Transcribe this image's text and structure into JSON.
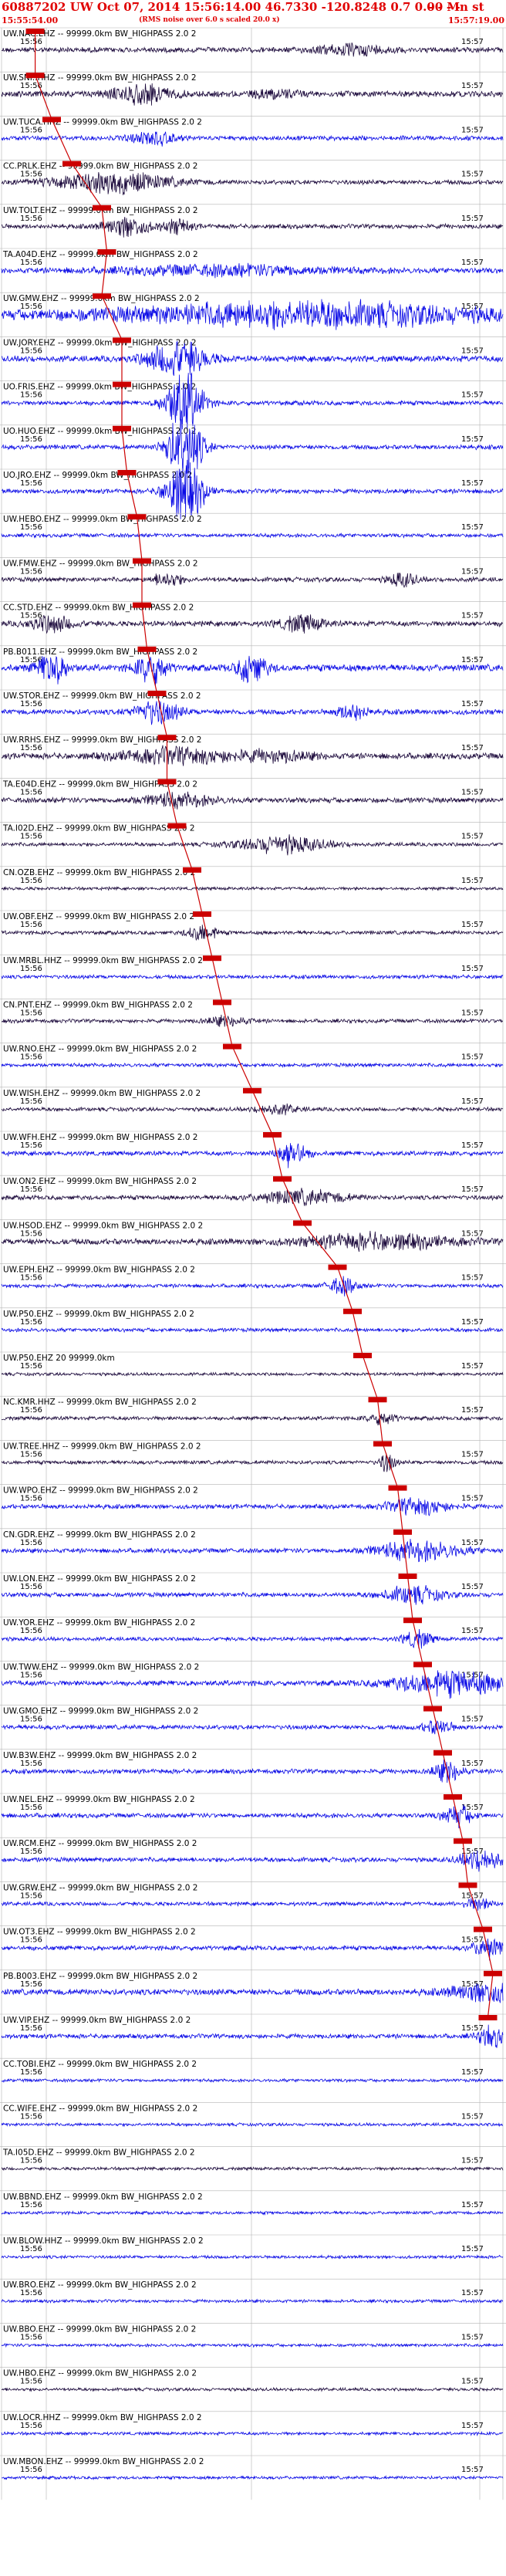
{
  "header": {
    "title": "60887202 UW Oct 07, 2014 15:56:14.00   46.7330 -120.8248  0.7 0.00 Mn st",
    "dashes": "- - - -",
    "start_time": "15:55:54.00",
    "rms_note": "(RMS noise over 6.0 s scaled 20.0 x)",
    "end_time": "15:57:19.00"
  },
  "colors": {
    "header": "#e00000",
    "pick": "#cc0000",
    "trace_alt": "#0a0ae6",
    "trace_base": "#1c0a3c",
    "grid": "#b4b4b4"
  },
  "chart_data": {
    "type": "line",
    "title": "60887202 UW Oct 07, 2014 15:56:14.00   46.7330 -120.8248  0.7 0.00 Mn st",
    "x_range": [
      "15:55:54.00",
      "15:57:19.00"
    ],
    "xlabel": "",
    "ylabel": "",
    "grid": true,
    "traces": [
      {
        "label": "UW.NAC.EHZ -- 99999.0km BW_HIGHPASS 2.0 2",
        "t1": "15:56",
        "t2": "15:57",
        "amp": 0.7,
        "pick": 0.067,
        "color": "dark",
        "bursts": [
          [
            0.7,
            0.05,
            1.6
          ]
        ]
      },
      {
        "label": "UW.SNI..HHZ -- 99999.0km BW_HIGHPASS 2.0 2",
        "t1": "15:56",
        "t2": "15:57",
        "amp": 0.8,
        "pick": 0.067,
        "color": "dark",
        "bursts": [
          [
            0.28,
            0.04,
            2
          ],
          [
            0.55,
            0.03,
            1.5
          ]
        ]
      },
      {
        "label": "UW.TUCA.HHZ -- 99999.0km BW_HIGHPASS 2.0 2",
        "t1": "15:56",
        "t2": "15:57",
        "amp": 0.6,
        "pick": 0.1,
        "color": "blue",
        "bursts": [
          [
            0.3,
            0.03,
            2
          ]
        ]
      },
      {
        "label": "CC.PRLK.EHZ -- 99999.0km BW_HIGHPASS 2.0 2",
        "t1": "15:56",
        "t2": "15:57",
        "amp": 0.6,
        "pick": 0.14,
        "color": "dark",
        "bursts": [
          [
            0.22,
            0.08,
            2.5
          ]
        ]
      },
      {
        "label": "UW.TOLT.EHZ -- 99999.0km BW_HIGHPASS 2.0 2",
        "t1": "15:56",
        "t2": "15:57",
        "amp": 0.6,
        "pick": 0.2,
        "color": "dark",
        "bursts": [
          [
            0.25,
            0.03,
            2.5
          ],
          [
            0.35,
            0.02,
            2
          ]
        ]
      },
      {
        "label": "TA.A04D.EHZ -- 99999.0km BW_HIGHPASS 2.0 2",
        "t1": "15:56",
        "t2": "15:57",
        "amp": 0.7,
        "pick": 0.21,
        "color": "blue",
        "bursts": [
          [
            0.45,
            0.15,
            1.6
          ]
        ]
      },
      {
        "label": "UW.GMW.EHZ -- 99999.0km BW_HIGHPASS 2.0 2",
        "t1": "15:56",
        "t2": "15:57",
        "amp": 1.2,
        "pick": 0.2,
        "color": "blue",
        "bursts": [
          [
            0.6,
            0.25,
            1.8
          ]
        ]
      },
      {
        "label": "UW.JORY.EHZ -- 99999.0km BW_HIGHPASS 2.0 2",
        "t1": "15:56",
        "t2": "15:57",
        "amp": 0.8,
        "pick": 0.24,
        "color": "blue",
        "bursts": [
          [
            0.35,
            0.04,
            3
          ]
        ]
      },
      {
        "label": "UO.FRIS.EHZ -- 99999.0km BW_HIGHPASS 2.0 2",
        "t1": "15:56",
        "t2": "15:57",
        "amp": 0.6,
        "pick": 0.24,
        "color": "blue",
        "bursts": [
          [
            0.35,
            0.02,
            4
          ],
          [
            0.38,
            0.02,
            4
          ]
        ]
      },
      {
        "label": "UO.HUO.EHZ -- 99999.0km BW_HIGHPASS 2.0 2",
        "t1": "15:56",
        "t2": "15:57",
        "amp": 0.6,
        "pick": 0.24,
        "color": "blue",
        "bursts": [
          [
            0.35,
            0.02,
            4
          ],
          [
            0.38,
            0.02,
            4
          ]
        ]
      },
      {
        "label": "UO.JRO.EHZ -- 99999.0km BW_HIGHPASS 2.0 2",
        "t1": "15:56",
        "t2": "15:57",
        "amp": 0.6,
        "pick": 0.25,
        "color": "blue",
        "bursts": [
          [
            0.35,
            0.02,
            4
          ],
          [
            0.38,
            0.02,
            4
          ]
        ]
      },
      {
        "label": "UW.HEBO.EHZ -- 99999.0km BW_HIGHPASS 2.0 2",
        "t1": "15:56",
        "t2": "15:57",
        "amp": 0.5,
        "pick": 0.27,
        "color": "blue",
        "bursts": []
      },
      {
        "label": "UW.FMW.EHZ -- 99999.0km BW_HIGHPASS 2.0 2",
        "t1": "15:56",
        "t2": "15:57",
        "amp": 0.6,
        "pick": 0.28,
        "color": "dark",
        "bursts": [
          [
            0.33,
            0.02,
            2
          ],
          [
            0.8,
            0.02,
            2
          ]
        ]
      },
      {
        "label": "CC.STD.EHZ -- 99999.0km BW_HIGHPASS 2.0 2",
        "t1": "15:56",
        "t2": "15:57",
        "amp": 0.7,
        "pick": 0.28,
        "color": "dark",
        "bursts": [
          [
            0.1,
            0.03,
            2
          ],
          [
            0.6,
            0.03,
            2
          ]
        ]
      },
      {
        "label": "PB.B011.EHZ -- 99999.0km BW_HIGHPASS 2.0 2",
        "t1": "15:56",
        "t2": "15:57",
        "amp": 0.9,
        "pick": 0.29,
        "color": "blue",
        "bursts": [
          [
            0.1,
            0.02,
            2.5
          ],
          [
            0.3,
            0.02,
            2.5
          ],
          [
            0.5,
            0.02,
            2.5
          ]
        ]
      },
      {
        "label": "UW.STOR.EHZ -- 99999.0km BW_HIGHPASS 2.0 2",
        "t1": "15:56",
        "t2": "15:57",
        "amp": 0.7,
        "pick": 0.31,
        "color": "blue",
        "bursts": [
          [
            0.31,
            0.03,
            2.5
          ],
          [
            0.7,
            0.02,
            2
          ]
        ]
      },
      {
        "label": "UW.RRHS.EHZ -- 99999.0km BW_HIGHPASS 2.0 2",
        "t1": "15:56",
        "t2": "15:57",
        "amp": 0.8,
        "pick": 0.33,
        "color": "dark",
        "bursts": [
          [
            0.35,
            0.08,
            1.8
          ],
          [
            0.55,
            0.05,
            1.5
          ]
        ]
      },
      {
        "label": "TA.E04D.EHZ -- 99999.0km BW_HIGHPASS 2.0 2",
        "t1": "15:56",
        "t2": "15:57",
        "amp": 0.7,
        "pick": 0.33,
        "color": "dark",
        "bursts": [
          [
            0.35,
            0.05,
            1.8
          ]
        ]
      },
      {
        "label": "TA.I02D.EHZ -- 99999.0km BW_HIGHPASS 2.0 2",
        "t1": "15:56",
        "t2": "15:57",
        "amp": 0.5,
        "pick": 0.35,
        "color": "dark",
        "bursts": [
          [
            0.56,
            0.06,
            2.5
          ]
        ]
      },
      {
        "label": "CN.OZB.EHZ -- 99999.0km BW_HIGHPASS 2.0 2",
        "t1": "15:56",
        "t2": "15:57",
        "amp": 0.4,
        "pick": 0.38,
        "color": "dark",
        "bursts": []
      },
      {
        "label": "UW.OBF.EHZ -- 99999.0km BW_HIGHPASS 2.0 2",
        "t1": "15:56",
        "t2": "15:57",
        "amp": 0.5,
        "pick": 0.4,
        "color": "dark",
        "bursts": [
          [
            0.4,
            0.02,
            2.5
          ]
        ]
      },
      {
        "label": "UW.MRBL.HHZ -- 99999.0km BW_HIGHPASS 2.0 2",
        "t1": "15:56",
        "t2": "15:57",
        "amp": 0.5,
        "pick": 0.42,
        "color": "blue",
        "bursts": []
      },
      {
        "label": "CN.PNT.EHZ -- 99999.0km BW_HIGHPASS 2.0 2",
        "t1": "15:56",
        "t2": "15:57",
        "amp": 0.5,
        "pick": 0.44,
        "color": "dark",
        "bursts": [
          [
            0.45,
            0.03,
            1.8
          ]
        ]
      },
      {
        "label": "UW.RNO.EHZ -- 99999.0km BW_HIGHPASS 2.0 2",
        "t1": "15:56",
        "t2": "15:57",
        "amp": 0.5,
        "pick": 0.46,
        "color": "blue",
        "bursts": []
      },
      {
        "label": "UW.WISH.EHZ -- 99999.0km BW_HIGHPASS 2.0 2",
        "t1": "15:56",
        "t2": "15:57",
        "amp": 0.5,
        "pick": 0.5,
        "color": "dark",
        "bursts": [
          [
            0.55,
            0.03,
            1.8
          ]
        ]
      },
      {
        "label": "UW.WFH.EHZ -- 99999.0km BW_HIGHPASS 2.0 2",
        "t1": "15:56",
        "t2": "15:57",
        "amp": 0.6,
        "pick": 0.54,
        "color": "blue",
        "bursts": [
          [
            0.58,
            0.02,
            3
          ]
        ]
      },
      {
        "label": "UW.ON2.EHZ -- 99999.0km BW_HIGHPASS 2.0 2",
        "t1": "15:56",
        "t2": "15:57",
        "amp": 0.6,
        "pick": 0.56,
        "color": "dark",
        "bursts": [
          [
            0.6,
            0.06,
            2
          ]
        ]
      },
      {
        "label": "UW.HSOD.EHZ -- 99999.0km BW_HIGHPASS 2.0 2",
        "t1": "15:56",
        "t2": "15:57",
        "amp": 0.8,
        "pick": 0.6,
        "color": "dark",
        "bursts": [
          [
            0.75,
            0.1,
            1.8
          ]
        ]
      },
      {
        "label": "UW.EPH.EHZ -- 99999.0km BW_HIGHPASS 2.0 2",
        "t1": "15:56",
        "t2": "15:57",
        "amp": 0.5,
        "pick": 0.67,
        "color": "blue",
        "bursts": [
          [
            0.68,
            0.02,
            2.5
          ]
        ]
      },
      {
        "label": "UW.P50.EHZ -- 99999.0km BW_HIGHPASS 2.0 2",
        "t1": "15:56",
        "t2": "15:57",
        "amp": 0.5,
        "pick": 0.7,
        "color": "blue",
        "bursts": []
      },
      {
        "label": "UW.P50.EHZ 20 99999.0km",
        "t1": "15:56",
        "t2": "15:57",
        "amp": 0.4,
        "pick": 0.72,
        "color": "dark",
        "bursts": []
      },
      {
        "label": "NC.KMR.HHZ -- 99999.0km BW_HIGHPASS 2.0 2",
        "t1": "15:56",
        "t2": "15:57",
        "amp": 0.5,
        "pick": 0.75,
        "color": "dark",
        "bursts": [
          [
            0.76,
            0.02,
            2
          ]
        ]
      },
      {
        "label": "UW.TREE.HHZ -- 99999.0km BW_HIGHPASS 2.0 2",
        "t1": "15:56",
        "t2": "15:57",
        "amp": 0.5,
        "pick": 0.76,
        "color": "dark",
        "bursts": [
          [
            0.77,
            0.01,
            3
          ]
        ]
      },
      {
        "label": "UW.WPO.EHZ -- 99999.0km BW_HIGHPASS 2.0 2",
        "t1": "15:56",
        "t2": "15:57",
        "amp": 0.6,
        "pick": 0.79,
        "color": "blue",
        "bursts": [
          [
            0.83,
            0.04,
            2.2
          ]
        ]
      },
      {
        "label": "CN.GDR.EHZ -- 99999.0km BW_HIGHPASS 2.0 2",
        "t1": "15:56",
        "t2": "15:57",
        "amp": 0.6,
        "pick": 0.8,
        "color": "blue",
        "bursts": [
          [
            0.83,
            0.06,
            2.4
          ]
        ]
      },
      {
        "label": "UW.LON.EHZ -- 99999.0km BW_HIGHPASS 2.0 2",
        "t1": "15:56",
        "t2": "15:57",
        "amp": 0.6,
        "pick": 0.81,
        "color": "blue",
        "bursts": [
          [
            0.82,
            0.04,
            2.2
          ]
        ]
      },
      {
        "label": "UW.YOR.EHZ -- 99999.0km BW_HIGHPASS 2.0 2",
        "t1": "15:56",
        "t2": "15:57",
        "amp": 0.5,
        "pick": 0.82,
        "color": "blue",
        "bursts": [
          [
            0.83,
            0.02,
            2.5
          ]
        ]
      },
      {
        "label": "UW.TWW.EHZ -- 99999.0km BW_HIGHPASS 2.0 2",
        "t1": "15:56",
        "t2": "15:57",
        "amp": 0.7,
        "pick": 0.84,
        "color": "blue",
        "bursts": [
          [
            0.9,
            0.08,
            2.5
          ]
        ]
      },
      {
        "label": "UW.GMO.EHZ -- 99999.0km BW_HIGHPASS 2.0 2",
        "t1": "15:56",
        "t2": "15:57",
        "amp": 0.6,
        "pick": 0.86,
        "color": "blue",
        "bursts": [
          [
            0.87,
            0.02,
            2
          ]
        ]
      },
      {
        "label": "UW.B3W.EHZ -- 99999.0km BW_HIGHPASS 2.0 2",
        "t1": "15:56",
        "t2": "15:57",
        "amp": 0.6,
        "pick": 0.88,
        "color": "blue",
        "bursts": [
          [
            0.89,
            0.02,
            2.5
          ]
        ]
      },
      {
        "label": "UW.NEL.EHZ -- 99999.0km BW_HIGHPASS 2.0 2",
        "t1": "15:56",
        "t2": "15:57",
        "amp": 0.6,
        "pick": 0.9,
        "color": "blue",
        "bursts": [
          [
            0.91,
            0.02,
            2.5
          ]
        ]
      },
      {
        "label": "UW.RCM.EHZ -- 99999.0km BW_HIGHPASS 2.0 2",
        "t1": "15:56",
        "t2": "15:57",
        "amp": 0.6,
        "pick": 0.92,
        "color": "blue",
        "bursts": [
          [
            0.96,
            0.03,
            2.5
          ]
        ]
      },
      {
        "label": "UW.GRW.EHZ -- 99999.0km BW_HIGHPASS 2.0 2",
        "t1": "15:56",
        "t2": "15:57",
        "amp": 0.5,
        "pick": 0.93,
        "color": "blue",
        "bursts": [
          [
            0.95,
            0.02,
            2
          ]
        ]
      },
      {
        "label": "UW.OT3.EHZ -- 99999.0km BW_HIGHPASS 2.0 2",
        "t1": "15:56",
        "t2": "15:57",
        "amp": 0.6,
        "pick": 0.96,
        "color": "blue",
        "bursts": [
          [
            0.97,
            0.02,
            2.5
          ]
        ]
      },
      {
        "label": "PB.B003.EHZ -- 99999.0km BW_HIGHPASS 2.0 2",
        "t1": "15:56",
        "t2": "15:57",
        "amp": 0.8,
        "pick": 0.98,
        "color": "blue",
        "bursts": [
          [
            0.97,
            0.05,
            2
          ]
        ]
      },
      {
        "label": "UW.VIP.EHZ -- 99999.0km BW_HIGHPASS 2.0 2",
        "t1": "15:56",
        "t2": "15:57",
        "amp": 0.6,
        "pick": 0.97,
        "color": "blue",
        "bursts": [
          [
            0.98,
            0.02,
            2.5
          ]
        ]
      },
      {
        "label": "CC.TOBI.EHZ -- 99999.0km BW_HIGHPASS 2.0 2",
        "t1": "15:56",
        "t2": "15:57",
        "amp": 0.4,
        "pick": null,
        "color": "blue",
        "bursts": []
      },
      {
        "label": "CC.WIFE.EHZ -- 99999.0km BW_HIGHPASS 2.0 2",
        "t1": "15:56",
        "t2": "15:57",
        "amp": 0.4,
        "pick": null,
        "color": "blue",
        "bursts": []
      },
      {
        "label": "TA.I05D.EHZ -- 99999.0km BW_HIGHPASS 2.0 2",
        "t1": "15:56",
        "t2": "15:57",
        "amp": 0.4,
        "pick": null,
        "color": "dark",
        "bursts": []
      },
      {
        "label": "UW.BBND.EHZ -- 99999.0km BW_HIGHPASS 2.0 2",
        "t1": "15:56",
        "t2": "15:57",
        "amp": 0.4,
        "pick": null,
        "color": "blue",
        "bursts": []
      },
      {
        "label": "UW.BLOW.HHZ -- 99999.0km BW_HIGHPASS 2.0 2",
        "t1": "15:56",
        "t2": "15:57",
        "amp": 0.4,
        "pick": null,
        "color": "blue",
        "bursts": []
      },
      {
        "label": "UW.BRO.EHZ -- 99999.0km BW_HIGHPASS 2.0 2",
        "t1": "15:56",
        "t2": "15:57",
        "amp": 0.4,
        "pick": null,
        "color": "blue",
        "bursts": []
      },
      {
        "label": "UW.BBO.EHZ -- 99999.0km BW_HIGHPASS 2.0 2",
        "t1": "15:56",
        "t2": "15:57",
        "amp": 0.4,
        "pick": null,
        "color": "blue",
        "bursts": []
      },
      {
        "label": "UW.HBO.EHZ -- 99999.0km BW_HIGHPASS 2.0 2",
        "t1": "15:56",
        "t2": "15:57",
        "amp": 0.4,
        "pick": null,
        "color": "dark",
        "bursts": []
      },
      {
        "label": "UW.LOCR.HHZ -- 99999.0km BW_HIGHPASS 2.0 2",
        "t1": "15:56",
        "t2": "15:57",
        "amp": 0.4,
        "pick": null,
        "color": "blue",
        "bursts": []
      },
      {
        "label": "UW.MBON.EHZ -- 99999.0km BW_HIGHPASS 2.0 2",
        "t1": "15:56",
        "t2": "15:57",
        "amp": 0.4,
        "pick": null,
        "color": "blue",
        "bursts": []
      }
    ]
  }
}
